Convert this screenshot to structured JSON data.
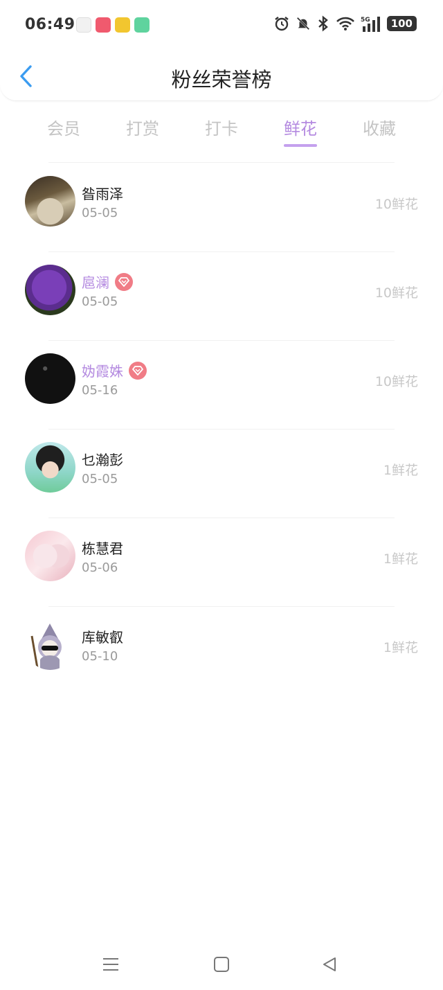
{
  "status_bar": {
    "time": "06:49",
    "network": "5G",
    "battery": "100"
  },
  "header": {
    "title": "粉丝荣誉榜",
    "back_icon": "chevron-left-icon"
  },
  "tabs": [
    {
      "label": "会员",
      "active": false
    },
    {
      "label": "打赏",
      "active": false
    },
    {
      "label": "打卡",
      "active": false
    },
    {
      "label": "鲜花",
      "active": true
    },
    {
      "label": "收藏",
      "active": false
    }
  ],
  "colors": {
    "accent": "#b48ae0",
    "badge": "#f07c86",
    "muted": "#c8c8c8",
    "back": "#3b9cf0"
  },
  "fans": [
    {
      "name": "昝雨泽",
      "date": "05-05",
      "flowers": "10鲜花",
      "vip": false
    },
    {
      "name": "扈澜",
      "date": "05-05",
      "flowers": "10鲜花",
      "vip": true
    },
    {
      "name": "妫霞姝",
      "date": "05-16",
      "flowers": "10鲜花",
      "vip": true
    },
    {
      "name": "乜瀚彭",
      "date": "05-05",
      "flowers": "1鲜花",
      "vip": false
    },
    {
      "name": "栋慧君",
      "date": "05-06",
      "flowers": "1鲜花",
      "vip": false
    },
    {
      "name": "库敏叡",
      "date": "05-10",
      "flowers": "1鲜花",
      "vip": false
    }
  ],
  "nav_bar": {
    "menu_icon": "menu-icon",
    "home_icon": "home-square-icon",
    "back_icon": "back-triangle-icon"
  }
}
